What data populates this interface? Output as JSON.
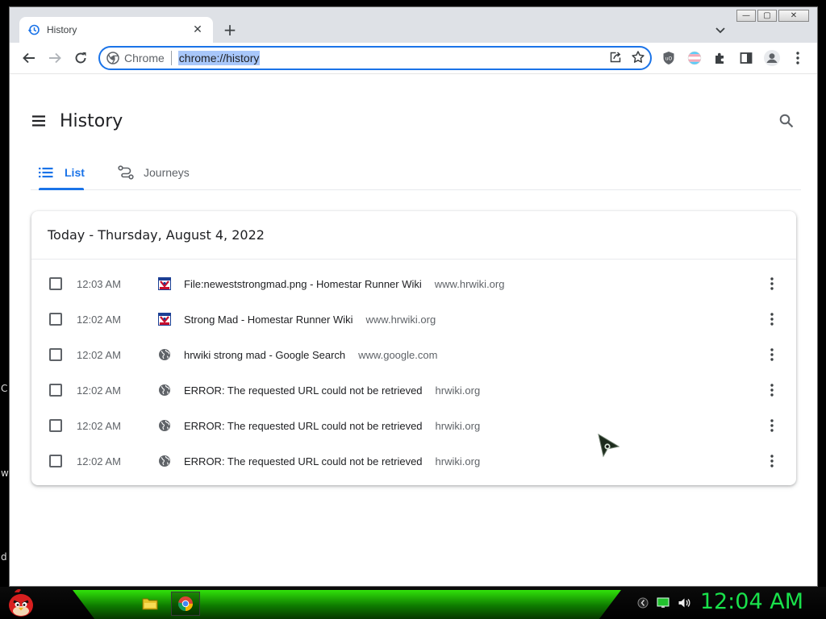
{
  "desktop": {
    "letters": [
      "C",
      "w",
      "d"
    ]
  },
  "window": {
    "controls": {
      "minimize": "—",
      "maximize": "▢",
      "close": "✕"
    }
  },
  "tab": {
    "title": "History",
    "close": "✕",
    "new_tab": "+"
  },
  "omnibox": {
    "security_label": "Chrome",
    "url": "chrome://history"
  },
  "page": {
    "title": "History",
    "tabs": [
      {
        "label": "List",
        "active": true
      },
      {
        "label": "Journeys",
        "active": false
      }
    ],
    "date_header": "Today - Thursday, August 4, 2022",
    "entries": [
      {
        "time": "12:03 AM",
        "title": "File:neweststrongmad.png - Homestar Runner Wiki",
        "domain": "www.hrwiki.org",
        "favicon": "hrwiki-icon"
      },
      {
        "time": "12:02 AM",
        "title": "Strong Mad - Homestar Runner Wiki",
        "domain": "www.hrwiki.org",
        "favicon": "hrwiki-icon"
      },
      {
        "time": "12:02 AM",
        "title": "hrwiki strong mad - Google Search",
        "domain": "www.google.com",
        "favicon": "globe-icon"
      },
      {
        "time": "12:02 AM",
        "title": "ERROR: The requested URL could not be retrieved",
        "domain": "hrwiki.org",
        "favicon": "globe-icon"
      },
      {
        "time": "12:02 AM",
        "title": "ERROR: The requested URL could not be retrieved",
        "domain": "hrwiki.org",
        "favicon": "globe-icon"
      },
      {
        "time": "12:02 AM",
        "title": "ERROR: The requested URL could not be retrieved",
        "domain": "hrwiki.org",
        "favicon": "globe-icon"
      }
    ]
  },
  "taskbar": {
    "clock": "12:04 AM"
  },
  "colors": {
    "accent": "#1a73e8",
    "clock": "#19e14b",
    "taskbar_green": "#31e20a"
  }
}
